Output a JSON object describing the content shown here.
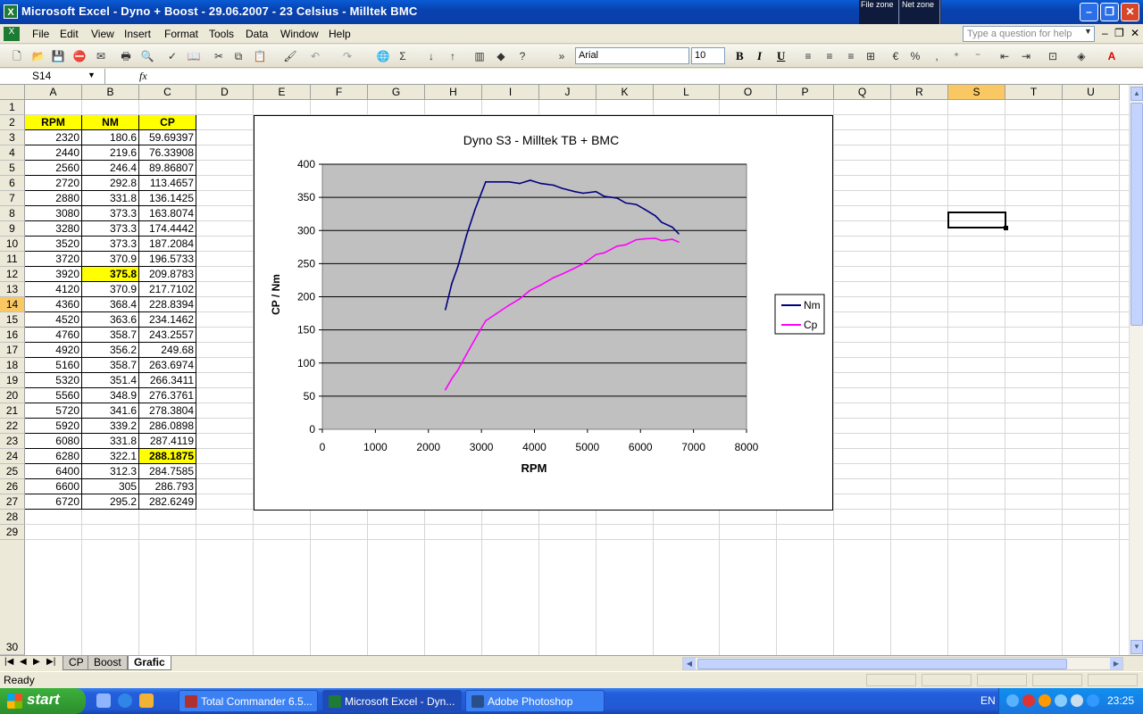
{
  "window": {
    "title": "Microsoft Excel - Dyno + Boost - 29.06.2007 - 23 Celsius - Milltek BMC",
    "zones": [
      "File zone",
      "Net zone"
    ]
  },
  "menu": {
    "items": [
      "File",
      "Edit",
      "View",
      "Insert",
      "Format",
      "Tools",
      "Data",
      "Window",
      "Help"
    ],
    "help_placeholder": "Type a question for help"
  },
  "toolbar": {
    "font": "Arial",
    "size": "10",
    "bold": "B",
    "italic": "I",
    "underline": "U",
    "percent": "%",
    "comma": ",",
    "sigma": "Σ"
  },
  "formula": {
    "namebox": "S14",
    "fx": "fx"
  },
  "sheet": {
    "columns": [
      "A",
      "B",
      "C",
      "D",
      "E",
      "F",
      "G",
      "H",
      "I",
      "J",
      "K",
      "L",
      "O",
      "P",
      "Q",
      "R",
      "S",
      "T",
      "U"
    ],
    "selected_column": "S",
    "selected_row": "14",
    "headers": [
      "RPM",
      "NM",
      "CP"
    ],
    "rows": [
      [
        "2320",
        "180.6",
        "59.69397"
      ],
      [
        "2440",
        "219.6",
        "76.33908"
      ],
      [
        "2560",
        "246.4",
        "89.86807"
      ],
      [
        "2720",
        "292.8",
        "113.4657"
      ],
      [
        "2880",
        "331.8",
        "136.1425"
      ],
      [
        "3080",
        "373.3",
        "163.8074"
      ],
      [
        "3280",
        "373.3",
        "174.4442"
      ],
      [
        "3520",
        "373.3",
        "187.2084"
      ],
      [
        "3720",
        "370.9",
        "196.5733"
      ],
      [
        "3920",
        "375.8",
        "209.8783"
      ],
      [
        "4120",
        "370.9",
        "217.7102"
      ],
      [
        "4360",
        "368.4",
        "228.8394"
      ],
      [
        "4520",
        "363.6",
        "234.1462"
      ],
      [
        "4760",
        "358.7",
        "243.2557"
      ],
      [
        "4920",
        "356.2",
        "249.68"
      ],
      [
        "5160",
        "358.7",
        "263.6974"
      ],
      [
        "5320",
        "351.4",
        "266.3411"
      ],
      [
        "5560",
        "348.9",
        "276.3761"
      ],
      [
        "5720",
        "341.6",
        "278.3804"
      ],
      [
        "5920",
        "339.2",
        "286.0898"
      ],
      [
        "6080",
        "331.8",
        "287.4119"
      ],
      [
        "6280",
        "322.1",
        "288.1875"
      ],
      [
        "6400",
        "312.3",
        "284.7585"
      ],
      [
        "6600",
        "305",
        "286.793"
      ],
      [
        "6720",
        "295.2",
        "282.6249"
      ]
    ],
    "row_numbers": [
      "1",
      "2",
      "3",
      "4",
      "5",
      "6",
      "7",
      "8",
      "9",
      "10",
      "11",
      "12",
      "13",
      "14",
      "15",
      "16",
      "17",
      "18",
      "19",
      "20",
      "21",
      "22",
      "23",
      "24",
      "25",
      "26",
      "27",
      "28",
      "29",
      "30"
    ]
  },
  "chart_data": {
    "type": "line",
    "title": "Dyno S3 - Milltek TB + BMC",
    "xlabel": "RPM",
    "ylabel": "CP / Nm",
    "xlim": [
      0,
      8000
    ],
    "ylim": [
      0,
      400
    ],
    "xticks": [
      0,
      1000,
      2000,
      3000,
      4000,
      5000,
      6000,
      7000,
      8000
    ],
    "yticks": [
      0,
      50,
      100,
      150,
      200,
      250,
      300,
      350,
      400
    ],
    "grid": "horizontal",
    "legend_position": "right",
    "plot_background": "#c0c0c0",
    "x": [
      2320,
      2440,
      2560,
      2720,
      2880,
      3080,
      3280,
      3520,
      3720,
      3920,
      4120,
      4360,
      4520,
      4760,
      4920,
      5160,
      5320,
      5560,
      5720,
      5920,
      6080,
      6280,
      6400,
      6600,
      6720
    ],
    "series": [
      {
        "name": "Nm",
        "color": "#000080",
        "values": [
          180.6,
          219.6,
          246.4,
          292.8,
          331.8,
          373.3,
          373.3,
          373.3,
          370.9,
          375.8,
          370.9,
          368.4,
          363.6,
          358.7,
          356.2,
          358.7,
          351.4,
          348.9,
          341.6,
          339.2,
          331.8,
          322.1,
          312.3,
          305,
          295.2
        ]
      },
      {
        "name": "Cp",
        "color": "#ff00ff",
        "values": [
          59.69397,
          76.33908,
          89.86807,
          113.4657,
          136.1425,
          163.8074,
          174.4442,
          187.2084,
          196.5733,
          209.8783,
          217.7102,
          228.8394,
          234.1462,
          243.2557,
          249.68,
          263.6974,
          266.3411,
          276.3761,
          278.3804,
          286.0898,
          287.4119,
          288.1875,
          284.7585,
          286.793,
          282.6249
        ]
      }
    ]
  },
  "tabs": [
    "CP",
    "Boost",
    "Grafic"
  ],
  "active_tab": "Grafic",
  "status": "Ready",
  "taskbar": {
    "start": "start",
    "tasks": [
      "Total Commander 6.5...",
      "Microsoft Excel - Dyn...",
      "Adobe Photoshop"
    ],
    "lang": "EN",
    "clock": "23:25"
  }
}
